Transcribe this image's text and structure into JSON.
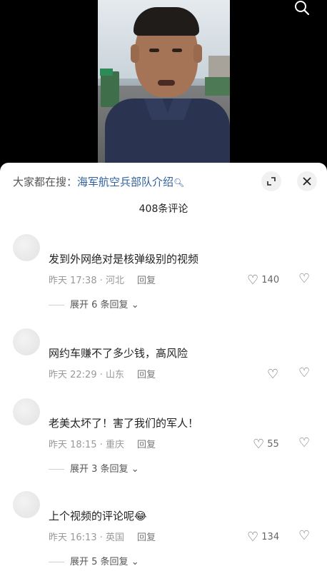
{
  "video": {
    "search_icon": "search-icon"
  },
  "panel": {
    "suggest_prefix": "大家都在搜：",
    "suggest_term": "海军航空兵部队介绍",
    "expand_icon": "expand-icon",
    "close_icon": "close-icon",
    "comment_count": "408条评论"
  },
  "comments": [
    {
      "text": "发到外网绝对是核弹级别的视频",
      "meta": "昨天 17:38 · 河北",
      "reply": "回复",
      "likes": "140",
      "expand": "展开 6 条回复"
    },
    {
      "text": "网约车赚不了多少钱，高风险",
      "meta": "昨天 22:29 · 山东",
      "reply": "回复",
      "likes": "",
      "expand": ""
    },
    {
      "text": "老美太坏了！害了我们的军人！",
      "meta": "昨天 18:15 · 重庆",
      "reply": "回复",
      "likes": "55",
      "expand": "展开 3 条回复"
    },
    {
      "text": "上个视频的评论呢😂",
      "meta": "昨天 16:13 · 英国",
      "reply": "回复",
      "likes": "134",
      "expand": "展开 5 条回复"
    }
  ]
}
